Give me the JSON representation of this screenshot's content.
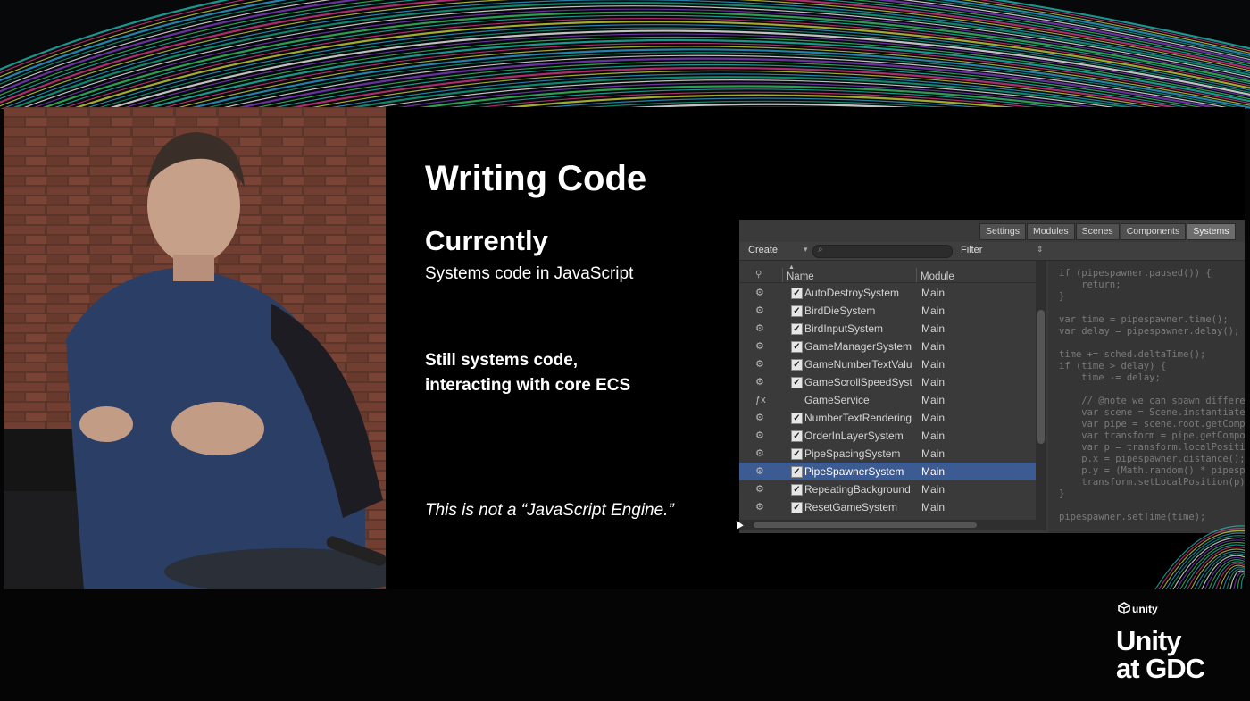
{
  "slide": {
    "title": "Writing Code",
    "heading": "Currently",
    "subtitle": "Systems code in JavaScript",
    "bullet_line1": "Still systems code,",
    "bullet_line2": "interacting with core ECS",
    "quote": "This is not a “JavaScript Engine.”"
  },
  "editor": {
    "tabs": [
      "Settings",
      "Modules",
      "Scenes",
      "Components",
      "Systems"
    ],
    "active_tab": "Systems",
    "toolbar": {
      "create_label": "Create",
      "filter_label": "Filter"
    },
    "columns": {
      "name": "Name",
      "module": "Module"
    },
    "rows": [
      {
        "name": "AutoDestroySystem",
        "module": "Main",
        "checked": true,
        "icon": "gears-icon"
      },
      {
        "name": "BirdDieSystem",
        "module": "Main",
        "checked": true,
        "icon": "gears-icon"
      },
      {
        "name": "BirdInputSystem",
        "module": "Main",
        "checked": true,
        "icon": "gears-icon"
      },
      {
        "name": "GameManagerSystem",
        "module": "Main",
        "checked": true,
        "icon": "gears-icon"
      },
      {
        "name": "GameNumberTextValu",
        "module": "Main",
        "checked": true,
        "icon": "gears-icon"
      },
      {
        "name": "GameScrollSpeedSyst",
        "module": "Main",
        "checked": true,
        "icon": "gears-icon"
      },
      {
        "name": "GameService",
        "module": "Main",
        "checked": false,
        "icon": "function-icon"
      },
      {
        "name": "NumberTextRendering",
        "module": "Main",
        "checked": true,
        "icon": "gears-icon"
      },
      {
        "name": "OrderInLayerSystem",
        "module": "Main",
        "checked": true,
        "icon": "gears-icon"
      },
      {
        "name": "PipeSpacingSystem",
        "module": "Main",
        "checked": true,
        "icon": "gears-icon"
      },
      {
        "name": "PipeSpawnerSystem",
        "module": "Main",
        "checked": true,
        "icon": "gears-icon",
        "selected": true
      },
      {
        "name": "RepeatingBackground",
        "module": "Main",
        "checked": true,
        "icon": "gears-icon"
      },
      {
        "name": "ResetGameSystem",
        "module": "Main",
        "checked": true,
        "icon": "gears-icon"
      }
    ],
    "code_lines": [
      "if (pipespawner.paused()) {",
      "    return;",
      "}",
      "",
      "var time = pipespawner.time();",
      "var delay = pipespawner.delay();",
      "",
      "time += sched.deltaTime();",
      "if (time > delay) {",
      "    time -= delay;",
      "",
      "    // @note we can spawn different t",
      "    var scene = Scene.instantiate('ga",
      "    var pipe = scene.root.getCompon",
      "    var transform = pipe.getCompone",
      "    var p = transform.localPosition();",
      "    p.x = pipespawner.distance();",
      "    p.y = (Math.random() * pipespawn",
      "    transform.setLocalPosition(p);",
      "}",
      "",
      "pipespawner.setTime(time);"
    ]
  },
  "branding": {
    "small": "unity",
    "line1": "Unity",
    "line2": "at GDC"
  },
  "colors": {
    "selection": "#3d5b93",
    "slide_bg": "#000000",
    "editor_bg": "#3a3a3a"
  }
}
